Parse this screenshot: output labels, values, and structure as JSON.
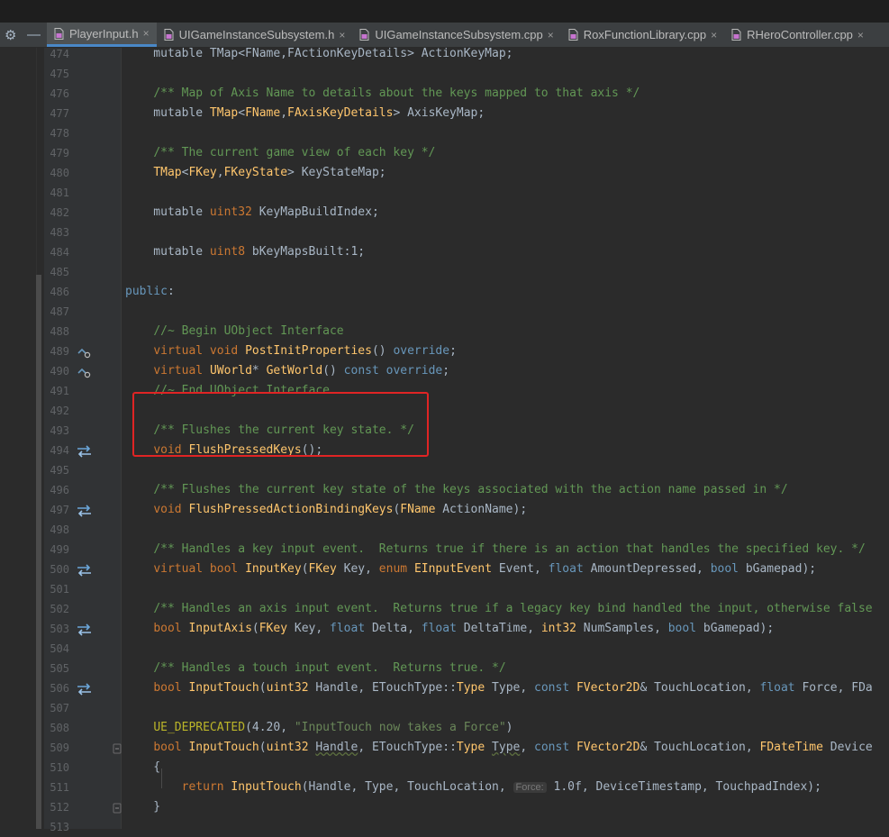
{
  "colors": {
    "accent": "#4a88c7",
    "highlight_box": "#e02424"
  },
  "toolbar": {
    "settings_icon": "gear-icon",
    "minimize_icon": "minus-icon"
  },
  "tabs": [
    {
      "label": "PlayerInput.h",
      "active": true,
      "icon": "header-file-icon"
    },
    {
      "label": "UIGameInstanceSubsystem.h",
      "active": false,
      "icon": "header-file-icon"
    },
    {
      "label": "UIGameInstanceSubsystem.cpp",
      "active": false,
      "icon": "cpp-file-icon"
    },
    {
      "label": "RoxFunctionLibrary.cpp",
      "active": false,
      "icon": "cpp-file-icon"
    },
    {
      "label": "RHeroController.cpp",
      "active": false,
      "icon": "cpp-file-icon"
    }
  ],
  "tab_close_label": "×",
  "editor": {
    "lines": [
      {
        "num": "474",
        "gutter": "",
        "tokens": [
          [
            "t-plain",
            "    mutable TMap<FName,FActionKeyDetails> ActionKeyMap;"
          ]
        ]
      },
      {
        "num": "475",
        "gutter": "",
        "tokens": []
      },
      {
        "num": "476",
        "gutter": "",
        "tokens": [
          [
            "t-plain",
            "    "
          ],
          [
            "t-comment",
            "/** Map of Axis Name to details about the keys mapped to that axis */"
          ]
        ]
      },
      {
        "num": "477",
        "gutter": "",
        "tokens": [
          [
            "t-plain",
            "    mutable "
          ],
          [
            "t-type",
            "TMap"
          ],
          [
            "t-plain",
            "<"
          ],
          [
            "t-type",
            "FName"
          ],
          [
            "t-plain",
            ","
          ],
          [
            "t-type",
            "FAxisKeyDetails"
          ],
          [
            "t-plain",
            "> AxisKeyMap;"
          ]
        ]
      },
      {
        "num": "478",
        "gutter": "",
        "tokens": []
      },
      {
        "num": "479",
        "gutter": "",
        "tokens": [
          [
            "t-plain",
            "    "
          ],
          [
            "t-comment",
            "/** The current game view of each key */"
          ]
        ]
      },
      {
        "num": "480",
        "gutter": "",
        "tokens": [
          [
            "t-plain",
            "    "
          ],
          [
            "t-type",
            "TMap"
          ],
          [
            "t-plain",
            "<"
          ],
          [
            "t-type",
            "FKey"
          ],
          [
            "t-plain",
            ","
          ],
          [
            "t-type",
            "FKeyState"
          ],
          [
            "t-plain",
            "> KeyStateMap;"
          ]
        ]
      },
      {
        "num": "481",
        "gutter": "",
        "tokens": []
      },
      {
        "num": "482",
        "gutter": "",
        "tokens": [
          [
            "t-plain",
            "    mutable "
          ],
          [
            "t-kw",
            "uint32"
          ],
          [
            "t-plain",
            " KeyMapBuildIndex;"
          ]
        ]
      },
      {
        "num": "483",
        "gutter": "",
        "tokens": []
      },
      {
        "num": "484",
        "gutter": "",
        "tokens": [
          [
            "t-plain",
            "    mutable "
          ],
          [
            "t-kw",
            "uint8"
          ],
          [
            "t-plain",
            " bKeyMapsBuilt:1;"
          ]
        ]
      },
      {
        "num": "485",
        "gutter": "",
        "tokens": []
      },
      {
        "num": "486",
        "gutter": "",
        "tokens": [
          [
            "t-blue",
            "public"
          ],
          [
            "t-plain",
            ":"
          ]
        ]
      },
      {
        "num": "487",
        "gutter": "",
        "tokens": []
      },
      {
        "num": "488",
        "gutter": "",
        "tokens": [
          [
            "t-plain",
            "    "
          ],
          [
            "t-comment",
            "//~ Begin UObject Interface"
          ]
        ]
      },
      {
        "num": "489",
        "gutter": "override",
        "tokens": [
          [
            "t-plain",
            "    "
          ],
          [
            "t-kw",
            "virtual void "
          ],
          [
            "t-func",
            "PostInitProperties"
          ],
          [
            "t-plain",
            "() "
          ],
          [
            "t-blue",
            "override"
          ],
          [
            "t-plain",
            ";"
          ]
        ]
      },
      {
        "num": "490",
        "gutter": "override",
        "tokens": [
          [
            "t-plain",
            "    "
          ],
          [
            "t-kw",
            "virtual "
          ],
          [
            "t-type",
            "UWorld"
          ],
          [
            "t-plain",
            "* "
          ],
          [
            "t-func",
            "GetWorld"
          ],
          [
            "t-plain",
            "() "
          ],
          [
            "t-blue",
            "const override"
          ],
          [
            "t-plain",
            ";"
          ]
        ]
      },
      {
        "num": "491",
        "gutter": "",
        "tokens": [
          [
            "t-plain",
            "    "
          ],
          [
            "t-comment",
            "//~ End UObject Interface"
          ]
        ]
      },
      {
        "num": "492",
        "gutter": "",
        "tokens": []
      },
      {
        "num": "493",
        "gutter": "",
        "tokens": [
          [
            "t-plain",
            "    "
          ],
          [
            "t-comment",
            "/** Flushes the current key state. */"
          ]
        ]
      },
      {
        "num": "494",
        "gutter": "swap",
        "tokens": [
          [
            "t-plain",
            "    "
          ],
          [
            "t-kw",
            "void "
          ],
          [
            "t-func",
            "FlushPressedKeys"
          ],
          [
            "t-plain",
            "();"
          ]
        ]
      },
      {
        "num": "495",
        "gutter": "",
        "tokens": []
      },
      {
        "num": "496",
        "gutter": "",
        "tokens": [
          [
            "t-plain",
            "    "
          ],
          [
            "t-comment",
            "/** Flushes the current key state of the keys associated with the action name passed in */"
          ]
        ]
      },
      {
        "num": "497",
        "gutter": "swap",
        "tokens": [
          [
            "t-plain",
            "    "
          ],
          [
            "t-kw",
            "void "
          ],
          [
            "t-func",
            "FlushPressedActionBindingKeys"
          ],
          [
            "t-plain",
            "("
          ],
          [
            "t-type",
            "FName"
          ],
          [
            "t-plain",
            " ActionName);"
          ]
        ]
      },
      {
        "num": "498",
        "gutter": "",
        "tokens": []
      },
      {
        "num": "499",
        "gutter": "",
        "tokens": [
          [
            "t-plain",
            "    "
          ],
          [
            "t-comment",
            "/** Handles a key input event.  Returns true if there is an action that handles the specified key. */"
          ]
        ]
      },
      {
        "num": "500",
        "gutter": "swap",
        "tokens": [
          [
            "t-plain",
            "    "
          ],
          [
            "t-kw",
            "virtual bool "
          ],
          [
            "t-func",
            "InputKey"
          ],
          [
            "t-plain",
            "("
          ],
          [
            "t-type",
            "FKey"
          ],
          [
            "t-plain",
            " Key, "
          ],
          [
            "t-kw",
            "enum "
          ],
          [
            "t-type",
            "EInputEvent"
          ],
          [
            "t-plain",
            " Event, "
          ],
          [
            "t-blue",
            "float"
          ],
          [
            "t-plain",
            " AmountDepressed, "
          ],
          [
            "t-blue",
            "bool"
          ],
          [
            "t-plain",
            " bGamepad);"
          ]
        ]
      },
      {
        "num": "501",
        "gutter": "",
        "tokens": []
      },
      {
        "num": "502",
        "gutter": "",
        "tokens": [
          [
            "t-plain",
            "    "
          ],
          [
            "t-comment",
            "/** Handles an axis input event.  Returns true if a legacy key bind handled the input, otherwise false"
          ]
        ]
      },
      {
        "num": "503",
        "gutter": "swap",
        "tokens": [
          [
            "t-plain",
            "    "
          ],
          [
            "t-kw",
            "bool "
          ],
          [
            "t-func",
            "InputAxis"
          ],
          [
            "t-plain",
            "("
          ],
          [
            "t-type",
            "FKey"
          ],
          [
            "t-plain",
            " Key, "
          ],
          [
            "t-blue",
            "float"
          ],
          [
            "t-plain",
            " Delta, "
          ],
          [
            "t-blue",
            "float"
          ],
          [
            "t-plain",
            " DeltaTime, "
          ],
          [
            "t-type",
            "int32"
          ],
          [
            "t-plain",
            " NumSamples, "
          ],
          [
            "t-blue",
            "bool"
          ],
          [
            "t-plain",
            " bGamepad);"
          ]
        ]
      },
      {
        "num": "504",
        "gutter": "",
        "tokens": []
      },
      {
        "num": "505",
        "gutter": "",
        "tokens": [
          [
            "t-plain",
            "    "
          ],
          [
            "t-comment",
            "/** Handles a touch input event.  Returns true. */"
          ]
        ]
      },
      {
        "num": "506",
        "gutter": "swap",
        "tokens": [
          [
            "t-plain",
            "    "
          ],
          [
            "t-kw",
            "bool "
          ],
          [
            "t-func",
            "InputTouch"
          ],
          [
            "t-plain",
            "("
          ],
          [
            "t-type",
            "uint32"
          ],
          [
            "t-plain",
            " Handle, ETouchType::"
          ],
          [
            "t-type",
            "Type"
          ],
          [
            "t-plain",
            " Type, "
          ],
          [
            "t-blue",
            "const "
          ],
          [
            "t-type",
            "FVector2D"
          ],
          [
            "t-plain",
            "& TouchLocation, "
          ],
          [
            "t-blue",
            "float"
          ],
          [
            "t-plain",
            " Force, FDa"
          ]
        ]
      },
      {
        "num": "507",
        "gutter": "",
        "tokens": []
      },
      {
        "num": "508",
        "gutter": "",
        "tokens": [
          [
            "t-plain",
            "    "
          ],
          [
            "t-macro",
            "UE_DEPRECATED"
          ],
          [
            "t-plain",
            "(4.20, "
          ],
          [
            "t-str",
            "\"InputTouch now takes a Force\""
          ],
          [
            "t-plain",
            ")"
          ]
        ]
      },
      {
        "num": "509",
        "gutter": "fold",
        "tokens": [
          [
            "t-plain",
            "    "
          ],
          [
            "t-kw",
            "bool "
          ],
          [
            "t-func",
            "InputTouch"
          ],
          [
            "t-plain",
            "("
          ],
          [
            "t-type",
            "uint32"
          ],
          [
            "t-plain",
            " "
          ],
          [
            "t-param",
            "Handle"
          ],
          [
            "t-plain",
            ", ETouchType::"
          ],
          [
            "t-type",
            "Type"
          ],
          [
            "t-plain",
            " "
          ],
          [
            "t-param",
            "Type"
          ],
          [
            "t-plain",
            ", "
          ],
          [
            "t-blue",
            "const "
          ],
          [
            "t-type",
            "FVector2D"
          ],
          [
            "t-plain",
            "& TouchLocation, "
          ],
          [
            "t-type",
            "FDateTime"
          ],
          [
            "t-plain",
            " Device"
          ]
        ]
      },
      {
        "num": "510",
        "gutter": "",
        "tokens": [
          [
            "t-plain",
            "    {"
          ]
        ]
      },
      {
        "num": "511",
        "gutter": "",
        "tokens": [
          [
            "t-plain",
            "        "
          ],
          [
            "t-kw",
            "return "
          ],
          [
            "t-func",
            "InputTouch"
          ],
          [
            "t-plain",
            "(Handle, Type, TouchLocation, "
          ],
          [
            "t-hint",
            "Force:"
          ],
          [
            "t-plain",
            " 1.0f, DeviceTimestamp, TouchpadIndex);"
          ]
        ]
      },
      {
        "num": "512",
        "gutter": "fold",
        "tokens": [
          [
            "t-plain",
            "    }"
          ]
        ]
      },
      {
        "num": "513",
        "gutter": "",
        "tokens": []
      }
    ]
  }
}
